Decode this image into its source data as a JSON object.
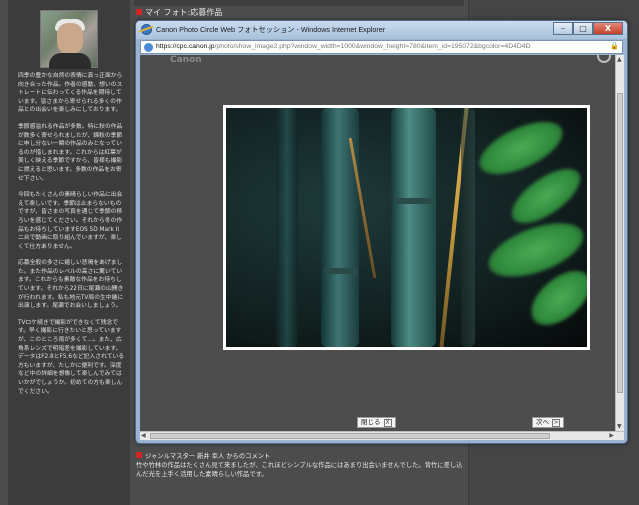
{
  "page": {
    "section_title": "マイ フォト:応募作品",
    "bio_paragraphs": [
      "四季の豊かな自然の表情に真っ正面から向き合った作品。作者の感動、想いのストレートに伝わってくる作品を期待しています。皆さまから寄せられる多くの作品との出会いを楽しみにしております。",
      "季節感溢れる作品が多数。特に秋の作品が数多く寄せられましたが、錦秋の季節に申し分ない一瞬の作品のみとなっているのが惜しまれます。これからは紅葉が美しく映える季節ですから、皆様も撮影に燃えると思います。多数の作品をお寄せ下さい。",
      "今回もたくさんの素晴らしい作品に出会えて楽しいです。季節は止まらないものですが、皆さまの写真を通じて季節の移ろいを感じてください。それから冬の作品もお待ちしていますEOS 5D Mark II 二台で動画に取り組んでいますが、楽しくて仕方ありません。",
      "応募全般の多さに嬉しい悲鳴をあげました。また作品のレベルの高さに驚いています。これからも素敵な作品をお待ちしています。それから22日に尾瀬の山開きが行われます。私も地元TV局の生中継に出演します。尾瀬でお会いしましょう。",
      "TVロケ続きで撮影ができなくて残念です。早く撮影に行きたいと思っていますが、このところ雨が多くて...。また、広角系レンズで明暗差を撮影しています。データはF2.8とF5.6など記入されている方もいますが、たしかに便利です。深度など中の詳細を想像して楽しんでみてはいかがでしょうか。初めての方も楽しんでください。"
    ],
    "comment_heading": "ジャンルマスター 新井 幸人 からのコメント",
    "comment_text": "竹や竹林の作品はたくさん見て来ましたが、これほどシンプルな作品にはあまり出会いませんでした。背竹に差し込んだ光を上手く活用した素晴らしい作品です。"
  },
  "browser": {
    "window_title": "Canon Photo Circle Web フォトセッション - Windows Internet Explorer",
    "address_domain": "https://cpc.canon.jp",
    "address_rest": "/photo/show_image2.php?window_width=1000&window_height=780&item_id=195072&bgcolor=4D4D4D",
    "minimize_label": "–",
    "maximize_label": "□",
    "close_label": "X",
    "lock_icon": "lock-icon"
  },
  "viewer": {
    "brand_text": "Canon",
    "close_button_label": "閉じる",
    "close_button_box": "X",
    "next_button_label": "次へ",
    "next_button_box": ">",
    "bgcolor": "#4D4D4D"
  },
  "colors": {
    "accent_red": "#d32424",
    "titlebar": "#a9c2dd"
  }
}
